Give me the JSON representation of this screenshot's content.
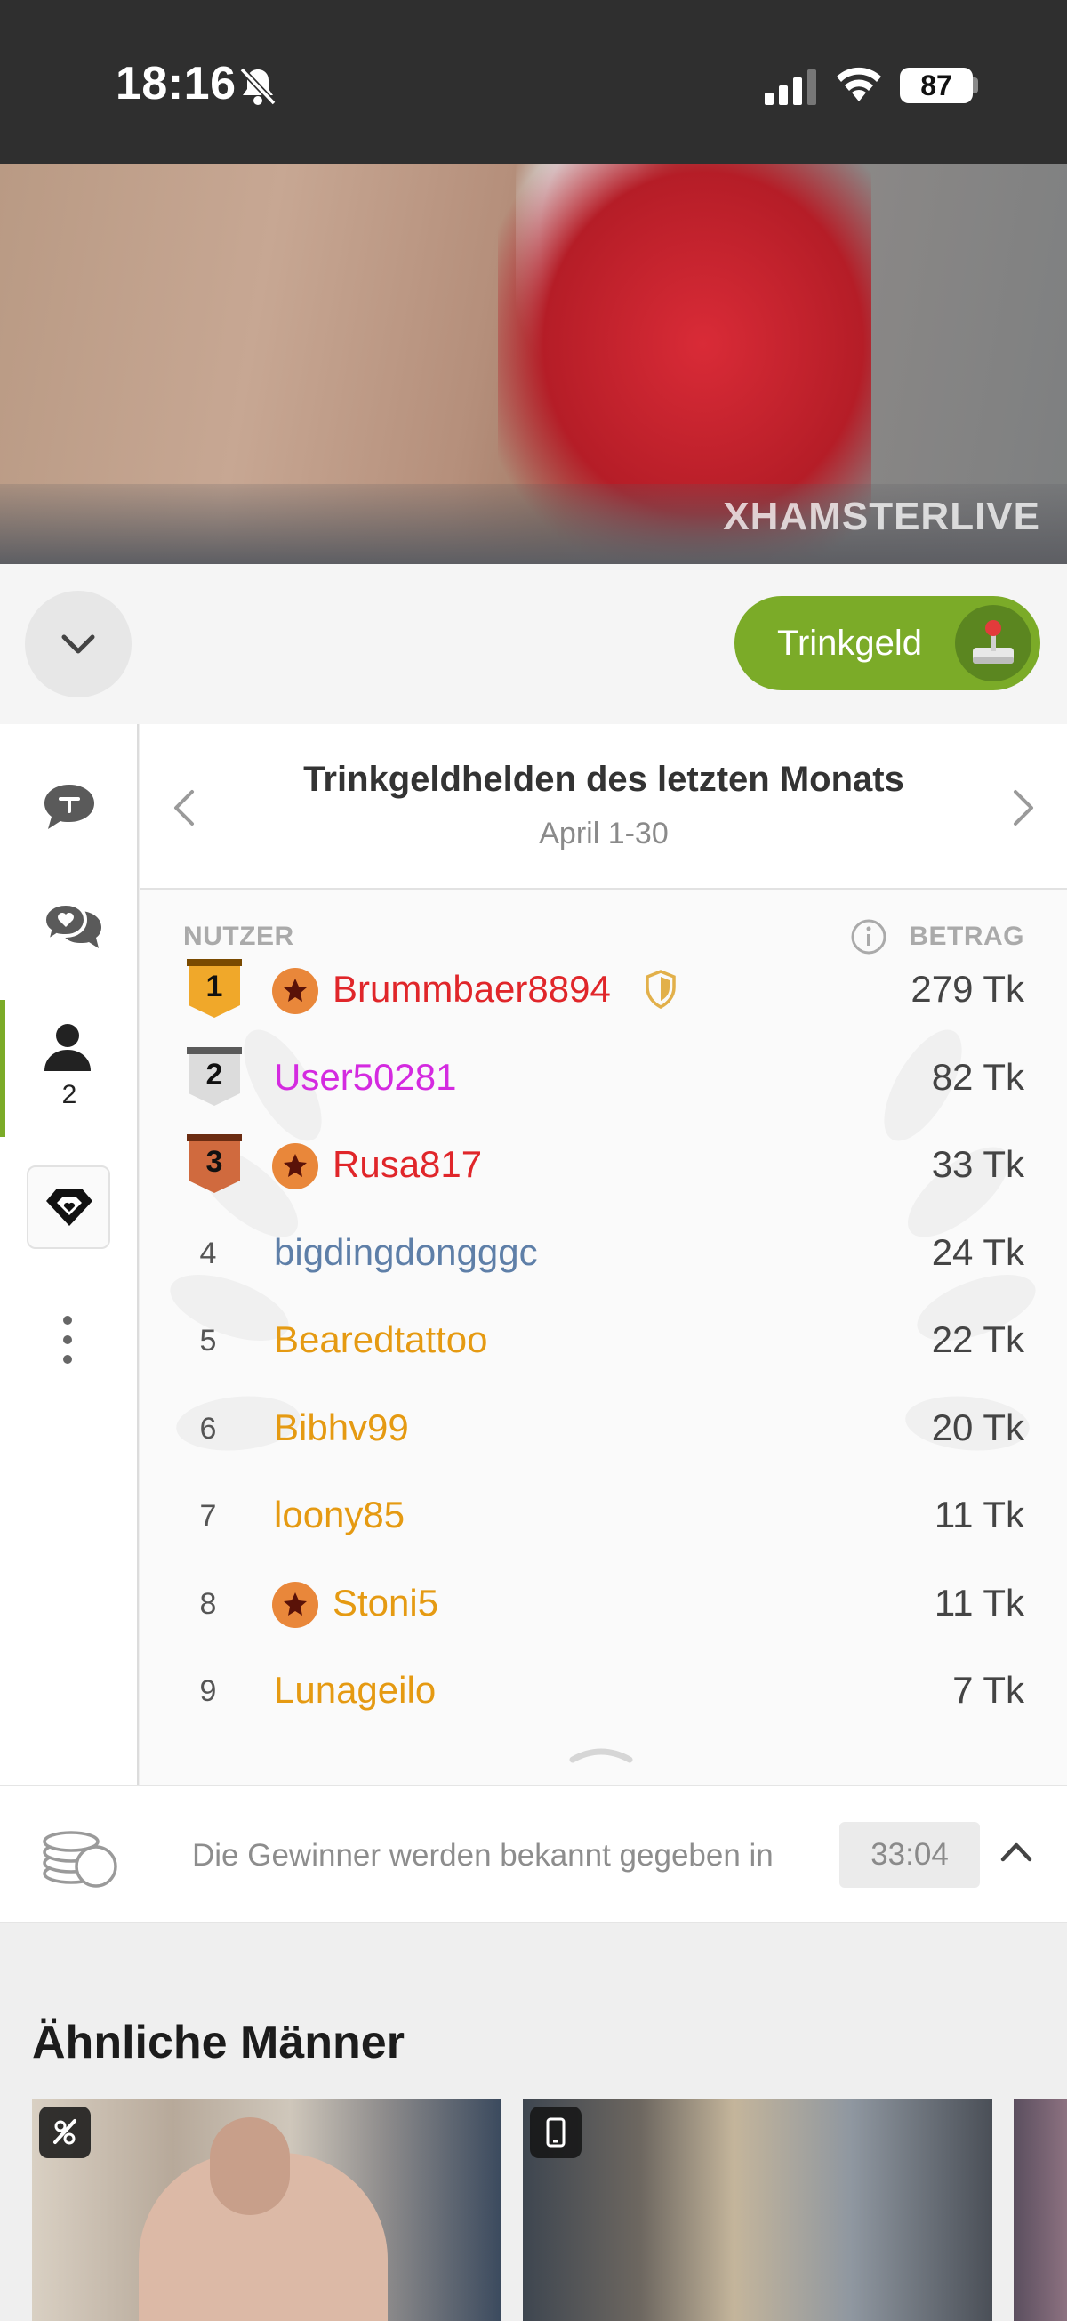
{
  "status_bar": {
    "time": "18:16",
    "battery": "87"
  },
  "video": {
    "watermark": "XHAMSTERLIVE"
  },
  "controls": {
    "tip_label": "Trinkgeld"
  },
  "sidebar": {
    "viewer_count": "2"
  },
  "leaderboard": {
    "title": "Trinkgeldhelden des letzten Monats",
    "period": "April 1-30",
    "col_user": "NUTZER",
    "col_amount": "BETRAG",
    "rows": [
      {
        "rank": "1",
        "name": "Brummbaer8894",
        "amount": "279 Tk",
        "color": "#e0262a",
        "star": true,
        "shield": true,
        "medal": "gold"
      },
      {
        "rank": "2",
        "name": "User50281",
        "amount": "82 Tk",
        "color": "#d42ae0",
        "star": false,
        "shield": false,
        "medal": "silver"
      },
      {
        "rank": "3",
        "name": "Rusa817",
        "amount": "33 Tk",
        "color": "#e0262a",
        "star": true,
        "shield": false,
        "medal": "bronze"
      },
      {
        "rank": "4",
        "name": "bigdingdongggc",
        "amount": "24 Tk",
        "color": "#5e7fa8",
        "star": false,
        "shield": false,
        "medal": "none"
      },
      {
        "rank": "5",
        "name": "Bearedtattoo",
        "amount": "22 Tk",
        "color": "#e59a12",
        "star": false,
        "shield": false,
        "medal": "none"
      },
      {
        "rank": "6",
        "name": "Bibhv99",
        "amount": "20 Tk",
        "color": "#e59a12",
        "star": false,
        "shield": false,
        "medal": "none"
      },
      {
        "rank": "7",
        "name": "loony85",
        "amount": "11 Tk",
        "color": "#e59a12",
        "star": false,
        "shield": false,
        "medal": "none"
      },
      {
        "rank": "8",
        "name": "Stoni5",
        "amount": "11 Tk",
        "color": "#e59a12",
        "star": true,
        "shield": false,
        "medal": "none"
      },
      {
        "rank": "9",
        "name": "Lunageilo",
        "amount": "7 Tk",
        "color": "#e59a12",
        "star": false,
        "shield": false,
        "medal": "none"
      }
    ]
  },
  "winner_bar": {
    "text": "Die Gewinner werden bekannt gegeben in",
    "timer": "33:04"
  },
  "similar": {
    "title": "Ähnliche Männer",
    "thumbs": [
      {
        "badge_icon": "vr-icon"
      },
      {
        "badge_icon": "mobile-icon"
      }
    ]
  },
  "colors": {
    "accent": "#7bab28",
    "status_bar": "#2f2f2f"
  }
}
